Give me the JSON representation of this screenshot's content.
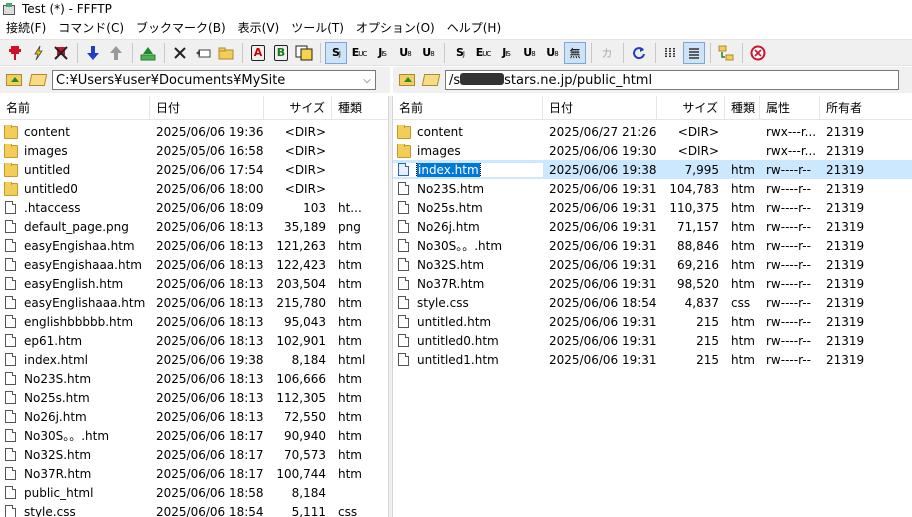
{
  "window": {
    "title": "Test (*) - FFFTP"
  },
  "menu": [
    "接続(F)",
    "コマンド(C)",
    "ブックマーク(B)",
    "表示(V)",
    "ツール(T)",
    "オプション(O)",
    "ヘルプ(H)"
  ],
  "toolbar": {
    "buttons": [
      {
        "name": "connect-icon"
      },
      {
        "name": "quick-connect-icon"
      },
      {
        "name": "disconnect-icon"
      },
      {
        "name": "download-icon"
      },
      {
        "name": "upload-icon"
      },
      {
        "name": "mirror-upload-icon"
      },
      {
        "name": "delete-icon"
      },
      {
        "name": "rename-icon"
      },
      {
        "name": "mkdir-icon"
      },
      {
        "name": "transfer-ascii-icon"
      },
      {
        "name": "transfer-binary-icon"
      },
      {
        "name": "transfer-auto-icon"
      },
      {
        "name": "kanji-sjis-icon"
      },
      {
        "name": "kanji-euc-icon"
      },
      {
        "name": "kanji-jis-icon"
      },
      {
        "name": "kanji-utf8-icon"
      },
      {
        "name": "kanji-utf8bom-icon"
      },
      {
        "name": "host-sjis-icon"
      },
      {
        "name": "host-euc-icon"
      },
      {
        "name": "host-jis-icon"
      },
      {
        "name": "host-utf8-icon"
      },
      {
        "name": "host-utf8bom-icon"
      },
      {
        "name": "no-convert-icon"
      },
      {
        "name": "kana-convert-icon"
      },
      {
        "name": "refresh-icon"
      },
      {
        "name": "list-view-icon"
      },
      {
        "name": "detail-view-icon"
      },
      {
        "name": "sync-folder-icon"
      },
      {
        "name": "stop-icon"
      }
    ],
    "labels": {
      "S": "S",
      "E": "E",
      "J": "J",
      "U": "U",
      "u8": "8",
      "jis": "JIS",
      "euc": "EUC",
      "sjis": "SJIS",
      "utf": "UTF",
      "none": "無",
      "kana": "カ",
      "A": "A",
      "B": "B"
    }
  },
  "local": {
    "path": "C:¥Users¥user¥Documents¥MySite",
    "columns": [
      "名前",
      "日付",
      "サイズ",
      "種類"
    ],
    "files": [
      {
        "name": "content",
        "date": "2025/06/06 19:36",
        "size": "<DIR>",
        "type": "",
        "kind": "folder"
      },
      {
        "name": "images",
        "date": "2025/05/06 16:58",
        "size": "<DIR>",
        "type": "",
        "kind": "folder"
      },
      {
        "name": "untitled",
        "date": "2025/06/06 17:54",
        "size": "<DIR>",
        "type": "",
        "kind": "folder"
      },
      {
        "name": "untitled0",
        "date": "2025/06/06 18:00",
        "size": "<DIR>",
        "type": "",
        "kind": "folder"
      },
      {
        "name": ".htaccess",
        "date": "2025/06/06 18:09",
        "size": "103",
        "type": "ht...",
        "kind": "file"
      },
      {
        "name": "default_page.png",
        "date": "2025/06/06 18:13",
        "size": "35,189",
        "type": "png",
        "kind": "file"
      },
      {
        "name": "easyEngishaa.htm",
        "date": "2025/06/06 18:13",
        "size": "121,263",
        "type": "htm",
        "kind": "file"
      },
      {
        "name": "easyEngishaaa.htm",
        "date": "2025/06/06 18:13",
        "size": "122,423",
        "type": "htm",
        "kind": "file"
      },
      {
        "name": "easyEnglish.htm",
        "date": "2025/06/06 18:13",
        "size": "203,504",
        "type": "htm",
        "kind": "file"
      },
      {
        "name": "easyEnglishaaa.htm",
        "date": "2025/06/06 18:13",
        "size": "215,780",
        "type": "htm",
        "kind": "file"
      },
      {
        "name": "englishbbbbb.htm",
        "date": "2025/06/06 18:13",
        "size": "95,043",
        "type": "htm",
        "kind": "file"
      },
      {
        "name": "ep61.htm",
        "date": "2025/06/06 18:13",
        "size": "102,901",
        "type": "htm",
        "kind": "file"
      },
      {
        "name": "index.html",
        "date": "2025/06/06 19:38",
        "size": "8,184",
        "type": "html",
        "kind": "file"
      },
      {
        "name": "No23S.htm",
        "date": "2025/06/06 18:13",
        "size": "106,666",
        "type": "htm",
        "kind": "file"
      },
      {
        "name": "No25s.htm",
        "date": "2025/06/06 18:13",
        "size": "112,305",
        "type": "htm",
        "kind": "file"
      },
      {
        "name": "No26j.htm",
        "date": "2025/06/06 18:13",
        "size": "72,550",
        "type": "htm",
        "kind": "file"
      },
      {
        "name": "No30S。。.htm",
        "date": "2025/06/06 18:17",
        "size": "90,940",
        "type": "htm",
        "kind": "file"
      },
      {
        "name": "No32S.htm",
        "date": "2025/06/06 18:17",
        "size": "70,573",
        "type": "htm",
        "kind": "file"
      },
      {
        "name": "No37R.htm",
        "date": "2025/06/06 18:17",
        "size": "100,744",
        "type": "htm",
        "kind": "file"
      },
      {
        "name": "public_html",
        "date": "2025/06/06 18:58",
        "size": "8,184",
        "type": "",
        "kind": "file"
      },
      {
        "name": "style.css",
        "date": "2025/06/06 18:54",
        "size": "5,111",
        "type": "css",
        "kind": "file"
      }
    ]
  },
  "remote": {
    "path_prefix": "/s",
    "path_suffix": "stars.ne.jp/public_html",
    "columns": [
      "名前",
      "日付",
      "サイズ",
      "種類",
      "属性",
      "所有者"
    ],
    "files": [
      {
        "name": "content",
        "date": "2025/06/27 21:26",
        "size": "<DIR>",
        "type": "",
        "attr": "rwx---r...",
        "owner": "21319",
        "kind": "folder"
      },
      {
        "name": "images",
        "date": "2025/06/06 19:30",
        "size": "<DIR>",
        "type": "",
        "attr": "rwx---r...",
        "owner": "21319",
        "kind": "folder"
      },
      {
        "name": "index.htm",
        "date": "2025/06/06 19:38",
        "size": "7,995",
        "type": "htm",
        "attr": "rw----r--",
        "owner": "21319",
        "kind": "file",
        "selected": true
      },
      {
        "name": "No23S.htm",
        "date": "2025/06/06 19:31",
        "size": "104,783",
        "type": "htm",
        "attr": "rw----r--",
        "owner": "21319",
        "kind": "file"
      },
      {
        "name": "No25s.htm",
        "date": "2025/06/06 19:31",
        "size": "110,375",
        "type": "htm",
        "attr": "rw----r--",
        "owner": "21319",
        "kind": "file"
      },
      {
        "name": "No26j.htm",
        "date": "2025/06/06 19:31",
        "size": "71,157",
        "type": "htm",
        "attr": "rw----r--",
        "owner": "21319",
        "kind": "file"
      },
      {
        "name": "No30S。。.htm",
        "date": "2025/06/06 19:31",
        "size": "88,846",
        "type": "htm",
        "attr": "rw----r--",
        "owner": "21319",
        "kind": "file"
      },
      {
        "name": "No32S.htm",
        "date": "2025/06/06 19:31",
        "size": "69,216",
        "type": "htm",
        "attr": "rw----r--",
        "owner": "21319",
        "kind": "file"
      },
      {
        "name": "No37R.htm",
        "date": "2025/06/06 19:31",
        "size": "98,520",
        "type": "htm",
        "attr": "rw----r--",
        "owner": "21319",
        "kind": "file"
      },
      {
        "name": "style.css",
        "date": "2025/06/06 18:54",
        "size": "4,837",
        "type": "css",
        "attr": "rw----r--",
        "owner": "21319",
        "kind": "file"
      },
      {
        "name": "untitled.htm",
        "date": "2025/06/06 19:31",
        "size": "215",
        "type": "htm",
        "attr": "rw----r--",
        "owner": "21319",
        "kind": "file"
      },
      {
        "name": "untitled0.htm",
        "date": "2025/06/06 19:31",
        "size": "215",
        "type": "htm",
        "attr": "rw----r--",
        "owner": "21319",
        "kind": "file"
      },
      {
        "name": "untitled1.htm",
        "date": "2025/06/06 19:31",
        "size": "215",
        "type": "htm",
        "attr": "rw----r--",
        "owner": "21319",
        "kind": "file"
      }
    ]
  },
  "colors": {
    "selection": "#0078d7",
    "selection_bg": "#cce8ff",
    "toolbar_bg": "#f0f0f0",
    "folder": "#f3cd5a"
  }
}
